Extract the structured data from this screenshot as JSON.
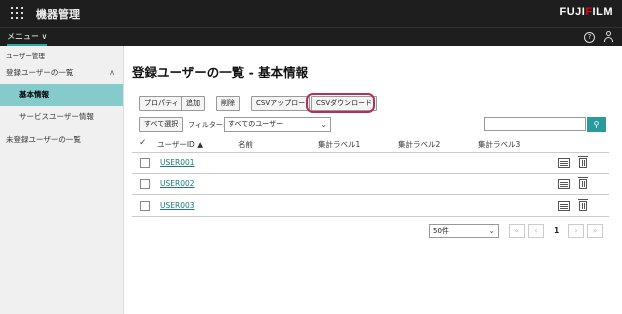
{
  "app": {
    "title": "機器管理",
    "brand_black": "FUJI",
    "brand_red": "F",
    "brand_rest": "ILM"
  },
  "menubar": {
    "menu_label": "メニュー ∨",
    "help_glyph": "?"
  },
  "sidebar": {
    "header": "ユーザー管理",
    "items": [
      {
        "label": "登録ユーザーの一覧",
        "chevron": "∧"
      },
      {
        "label": "基本情報"
      },
      {
        "label": "サービスユーザー情報"
      },
      {
        "label": "未登録ユーザーの一覧"
      }
    ]
  },
  "main": {
    "title": "登録ユーザーの一覧 - 基本情報",
    "toolbar": {
      "properties": "プロパティ",
      "add": "追加",
      "delete": "削除",
      "csv_upload": "CSVアップロー",
      "csv_download": "CSVダウンロード"
    },
    "select_all": "すべて選択",
    "filter_label": "フィルター:",
    "filter_value": "すべてのユーザー",
    "search_placeholder": "",
    "search_glyph": "⚲",
    "columns": {
      "check": "✓",
      "user_id": "ユーザーID ▲",
      "name": "名前",
      "label1": "集計ラベル1",
      "label2": "集計ラベル2",
      "label3": "集計ラベル3"
    },
    "rows": [
      {
        "user_id": "USER001"
      },
      {
        "user_id": "USER002"
      },
      {
        "user_id": "USER003"
      }
    ],
    "pager": {
      "per_page": "50件",
      "first": "«",
      "prev": "‹",
      "page": "1",
      "next": "›",
      "last": "»"
    }
  },
  "colors": {
    "accent": "#2a9a9a",
    "highlight": "#b0325c",
    "sidebar_active": "#86cbcb",
    "topbar": "#1e1e1e"
  }
}
